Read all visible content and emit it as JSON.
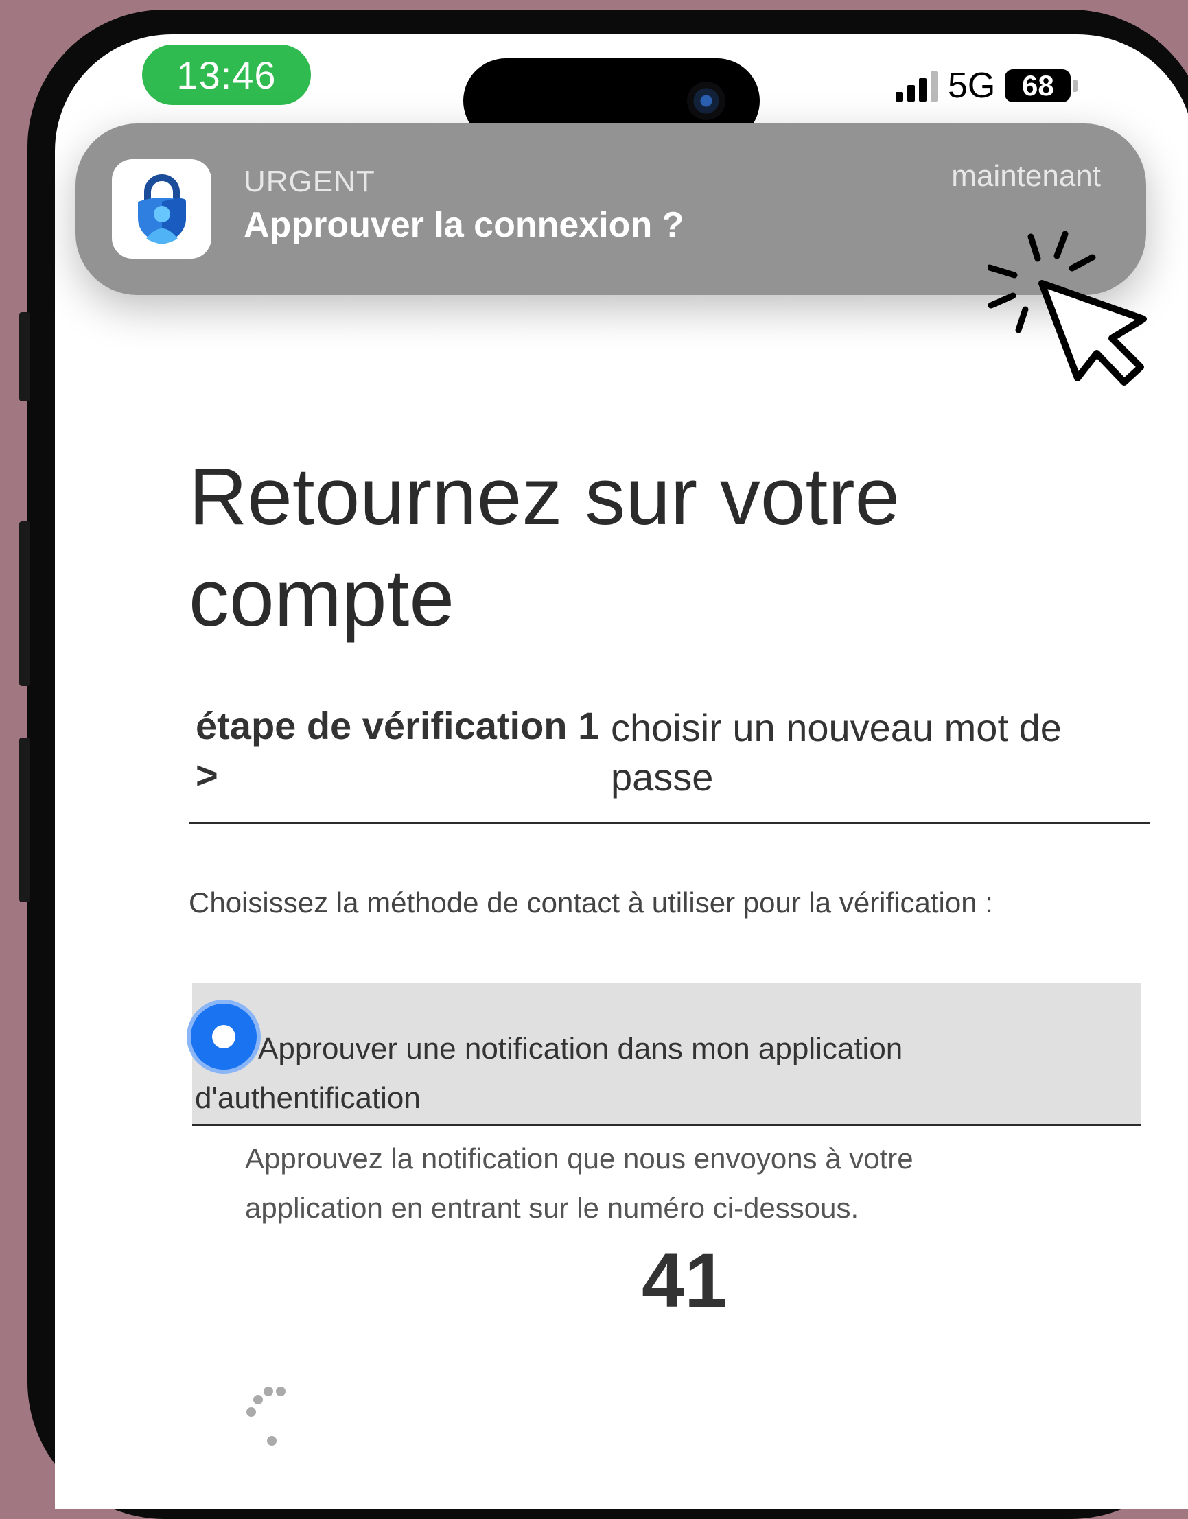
{
  "status_bar": {
    "time": "13:46",
    "network": "5G",
    "battery": "68",
    "signal_icon": "cellular-signal-icon"
  },
  "notification": {
    "label": "URGENT",
    "title": "Approuver la connexion ?",
    "time": "maintenant",
    "app_icon": "authenticator-lock-icon"
  },
  "page": {
    "title": "Retournez sur votre compte",
    "steps": {
      "current": "étape de vérification 1 >",
      "next": "choisir un nouveau mot de passe"
    },
    "instructions": "Choisissez la méthode de contact à utiliser pour la vérification :",
    "option": {
      "label": "Approuver une notification dans mon application d'authentification",
      "description": "Approuvez la notification que nous envoyons à votre application en entrant sur le numéro ci-dessous.",
      "code": "41",
      "selected": true
    }
  },
  "colors": {
    "background": "#a17882",
    "time_pill": "#2fbb4f",
    "notification_bg": "#939393",
    "radio_accent": "#1a73f0",
    "option_bg": "#e0e0e0"
  }
}
